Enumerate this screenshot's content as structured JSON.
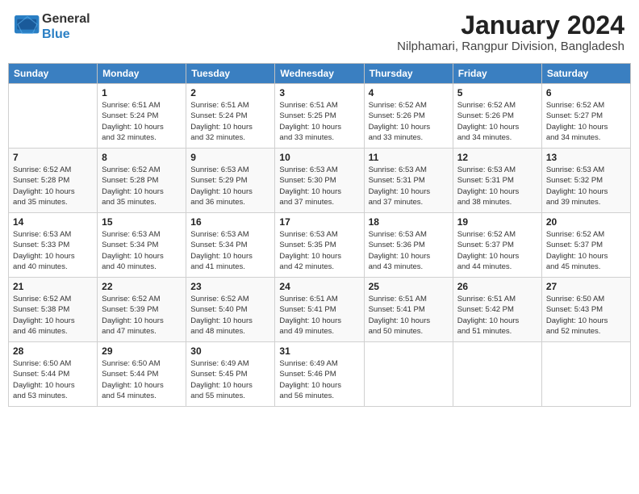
{
  "logo": {
    "text_general": "General",
    "text_blue": "Blue"
  },
  "title": "January 2024",
  "subtitle": "Nilphamari, Rangpur Division, Bangladesh",
  "headers": [
    "Sunday",
    "Monday",
    "Tuesday",
    "Wednesday",
    "Thursday",
    "Friday",
    "Saturday"
  ],
  "weeks": [
    [
      {
        "day": "",
        "detail": ""
      },
      {
        "day": "1",
        "detail": "Sunrise: 6:51 AM\nSunset: 5:24 PM\nDaylight: 10 hours\nand 32 minutes."
      },
      {
        "day": "2",
        "detail": "Sunrise: 6:51 AM\nSunset: 5:24 PM\nDaylight: 10 hours\nand 32 minutes."
      },
      {
        "day": "3",
        "detail": "Sunrise: 6:51 AM\nSunset: 5:25 PM\nDaylight: 10 hours\nand 33 minutes."
      },
      {
        "day": "4",
        "detail": "Sunrise: 6:52 AM\nSunset: 5:26 PM\nDaylight: 10 hours\nand 33 minutes."
      },
      {
        "day": "5",
        "detail": "Sunrise: 6:52 AM\nSunset: 5:26 PM\nDaylight: 10 hours\nand 34 minutes."
      },
      {
        "day": "6",
        "detail": "Sunrise: 6:52 AM\nSunset: 5:27 PM\nDaylight: 10 hours\nand 34 minutes."
      }
    ],
    [
      {
        "day": "7",
        "detail": "Sunrise: 6:52 AM\nSunset: 5:28 PM\nDaylight: 10 hours\nand 35 minutes."
      },
      {
        "day": "8",
        "detail": "Sunrise: 6:52 AM\nSunset: 5:28 PM\nDaylight: 10 hours\nand 35 minutes."
      },
      {
        "day": "9",
        "detail": "Sunrise: 6:53 AM\nSunset: 5:29 PM\nDaylight: 10 hours\nand 36 minutes."
      },
      {
        "day": "10",
        "detail": "Sunrise: 6:53 AM\nSunset: 5:30 PM\nDaylight: 10 hours\nand 37 minutes."
      },
      {
        "day": "11",
        "detail": "Sunrise: 6:53 AM\nSunset: 5:31 PM\nDaylight: 10 hours\nand 37 minutes."
      },
      {
        "day": "12",
        "detail": "Sunrise: 6:53 AM\nSunset: 5:31 PM\nDaylight: 10 hours\nand 38 minutes."
      },
      {
        "day": "13",
        "detail": "Sunrise: 6:53 AM\nSunset: 5:32 PM\nDaylight: 10 hours\nand 39 minutes."
      }
    ],
    [
      {
        "day": "14",
        "detail": "Sunrise: 6:53 AM\nSunset: 5:33 PM\nDaylight: 10 hours\nand 40 minutes."
      },
      {
        "day": "15",
        "detail": "Sunrise: 6:53 AM\nSunset: 5:34 PM\nDaylight: 10 hours\nand 40 minutes."
      },
      {
        "day": "16",
        "detail": "Sunrise: 6:53 AM\nSunset: 5:34 PM\nDaylight: 10 hours\nand 41 minutes."
      },
      {
        "day": "17",
        "detail": "Sunrise: 6:53 AM\nSunset: 5:35 PM\nDaylight: 10 hours\nand 42 minutes."
      },
      {
        "day": "18",
        "detail": "Sunrise: 6:53 AM\nSunset: 5:36 PM\nDaylight: 10 hours\nand 43 minutes."
      },
      {
        "day": "19",
        "detail": "Sunrise: 6:52 AM\nSunset: 5:37 PM\nDaylight: 10 hours\nand 44 minutes."
      },
      {
        "day": "20",
        "detail": "Sunrise: 6:52 AM\nSunset: 5:37 PM\nDaylight: 10 hours\nand 45 minutes."
      }
    ],
    [
      {
        "day": "21",
        "detail": "Sunrise: 6:52 AM\nSunset: 5:38 PM\nDaylight: 10 hours\nand 46 minutes."
      },
      {
        "day": "22",
        "detail": "Sunrise: 6:52 AM\nSunset: 5:39 PM\nDaylight: 10 hours\nand 47 minutes."
      },
      {
        "day": "23",
        "detail": "Sunrise: 6:52 AM\nSunset: 5:40 PM\nDaylight: 10 hours\nand 48 minutes."
      },
      {
        "day": "24",
        "detail": "Sunrise: 6:51 AM\nSunset: 5:41 PM\nDaylight: 10 hours\nand 49 minutes."
      },
      {
        "day": "25",
        "detail": "Sunrise: 6:51 AM\nSunset: 5:41 PM\nDaylight: 10 hours\nand 50 minutes."
      },
      {
        "day": "26",
        "detail": "Sunrise: 6:51 AM\nSunset: 5:42 PM\nDaylight: 10 hours\nand 51 minutes."
      },
      {
        "day": "27",
        "detail": "Sunrise: 6:50 AM\nSunset: 5:43 PM\nDaylight: 10 hours\nand 52 minutes."
      }
    ],
    [
      {
        "day": "28",
        "detail": "Sunrise: 6:50 AM\nSunset: 5:44 PM\nDaylight: 10 hours\nand 53 minutes."
      },
      {
        "day": "29",
        "detail": "Sunrise: 6:50 AM\nSunset: 5:44 PM\nDaylight: 10 hours\nand 54 minutes."
      },
      {
        "day": "30",
        "detail": "Sunrise: 6:49 AM\nSunset: 5:45 PM\nDaylight: 10 hours\nand 55 minutes."
      },
      {
        "day": "31",
        "detail": "Sunrise: 6:49 AM\nSunset: 5:46 PM\nDaylight: 10 hours\nand 56 minutes."
      },
      {
        "day": "",
        "detail": ""
      },
      {
        "day": "",
        "detail": ""
      },
      {
        "day": "",
        "detail": ""
      }
    ]
  ]
}
